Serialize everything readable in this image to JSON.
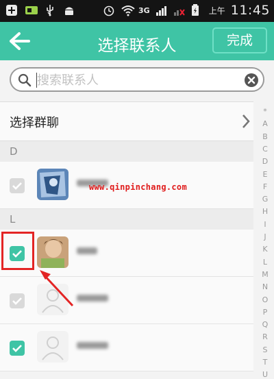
{
  "status_bar": {
    "network_type": "3G",
    "ampm": "上午",
    "time": "11:45",
    "icons": [
      "plus-icon",
      "sim-icon",
      "usb-icon",
      "android-icon",
      "alarm-icon",
      "wifi-icon",
      "signal-icon",
      "signal-icon-2",
      "battery-icon"
    ]
  },
  "header": {
    "title": "选择联系人",
    "done_label": "完成",
    "back_icon": "back-arrow-icon"
  },
  "search": {
    "placeholder": "搜索联系人",
    "value": ""
  },
  "group_chat": {
    "label": "选择群聊"
  },
  "sections": [
    {
      "letter": "D"
    },
    {
      "letter": "L"
    }
  ],
  "contacts": [
    {
      "section": "D",
      "checked": false
    },
    {
      "section": "L",
      "checked": true
    },
    {
      "section": "L",
      "checked": false
    },
    {
      "section": "L",
      "checked": true
    }
  ],
  "watermark": "www.qinpinchang.com",
  "index_letters": [
    "*",
    "A",
    "B",
    "C",
    "D",
    "E",
    "F",
    "G",
    "H",
    "I",
    "J",
    "K",
    "L",
    "M",
    "N",
    "O",
    "P",
    "Q",
    "R",
    "S",
    "T",
    "U"
  ],
  "colors": {
    "accent": "#3fc4a5",
    "highlight": "#e32424",
    "unchecked": "#d9d9d9"
  }
}
